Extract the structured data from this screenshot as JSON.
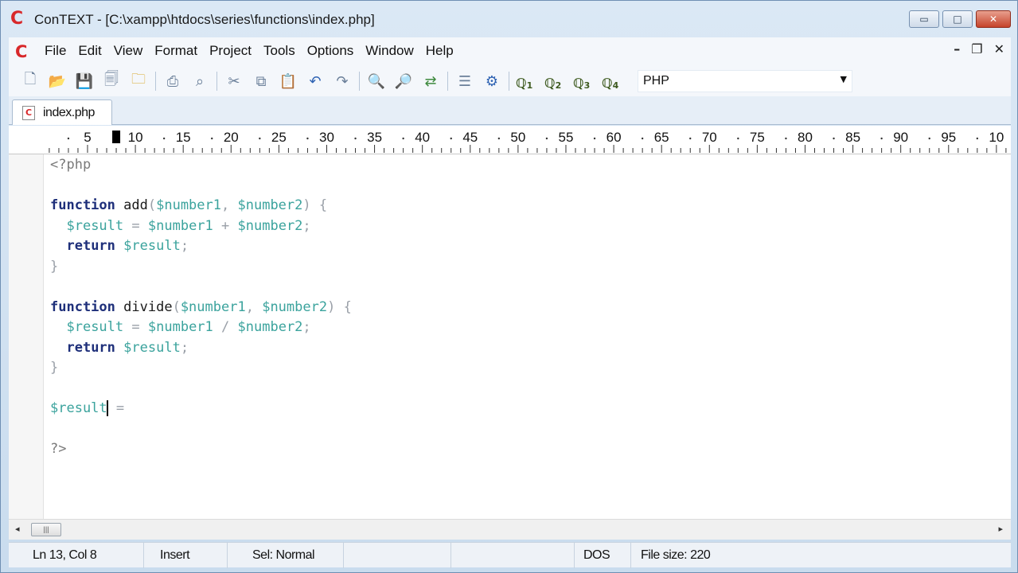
{
  "window": {
    "title": "ConTEXT - [C:\\xampp\\htdocs\\series\\functions\\index.php]",
    "app_logo": "C",
    "minimize_label": "▭",
    "maximize_label": "□",
    "close_label": "✕"
  },
  "menu": {
    "items": [
      "File",
      "Edit",
      "View",
      "Format",
      "Project",
      "Tools",
      "Options",
      "Window",
      "Help"
    ],
    "mdi_minimize": "–",
    "mdi_restore": "❐",
    "mdi_close": "✕"
  },
  "toolbar": {
    "language": "PHP",
    "user_commands": [
      "1",
      "2",
      "3",
      "4"
    ]
  },
  "tabs": [
    {
      "label": "index.php"
    }
  ],
  "ruler": {
    "labels": [
      "5",
      "10",
      "15",
      "20",
      "25",
      "30",
      "35",
      "40",
      "45",
      "50",
      "55",
      "60",
      "65",
      "70",
      "75",
      "80",
      "85",
      "90",
      "95",
      "10"
    ],
    "cursor_column": 8
  },
  "code": {
    "lines": [
      "<?php",
      "",
      "function add($number1, $number2) {",
      "  $result = $number1 + $number2;",
      "  return $result;",
      "}",
      "",
      "function divide($number1, $number2) {",
      "  $result = $number1 / $number2;",
      "  return $result;",
      "}",
      "",
      "$result =",
      "",
      "?>"
    ]
  },
  "statusbar": {
    "position": "Ln 13, Col 8",
    "mode": "Insert",
    "selection": "Sel: Normal",
    "line_ending": "DOS",
    "file_size": "File size: 220"
  },
  "colors": {
    "keyword": "#1e2f7a",
    "variable": "#3ba39d",
    "operator": "#9aa0a8",
    "logo": "#d8282a"
  }
}
